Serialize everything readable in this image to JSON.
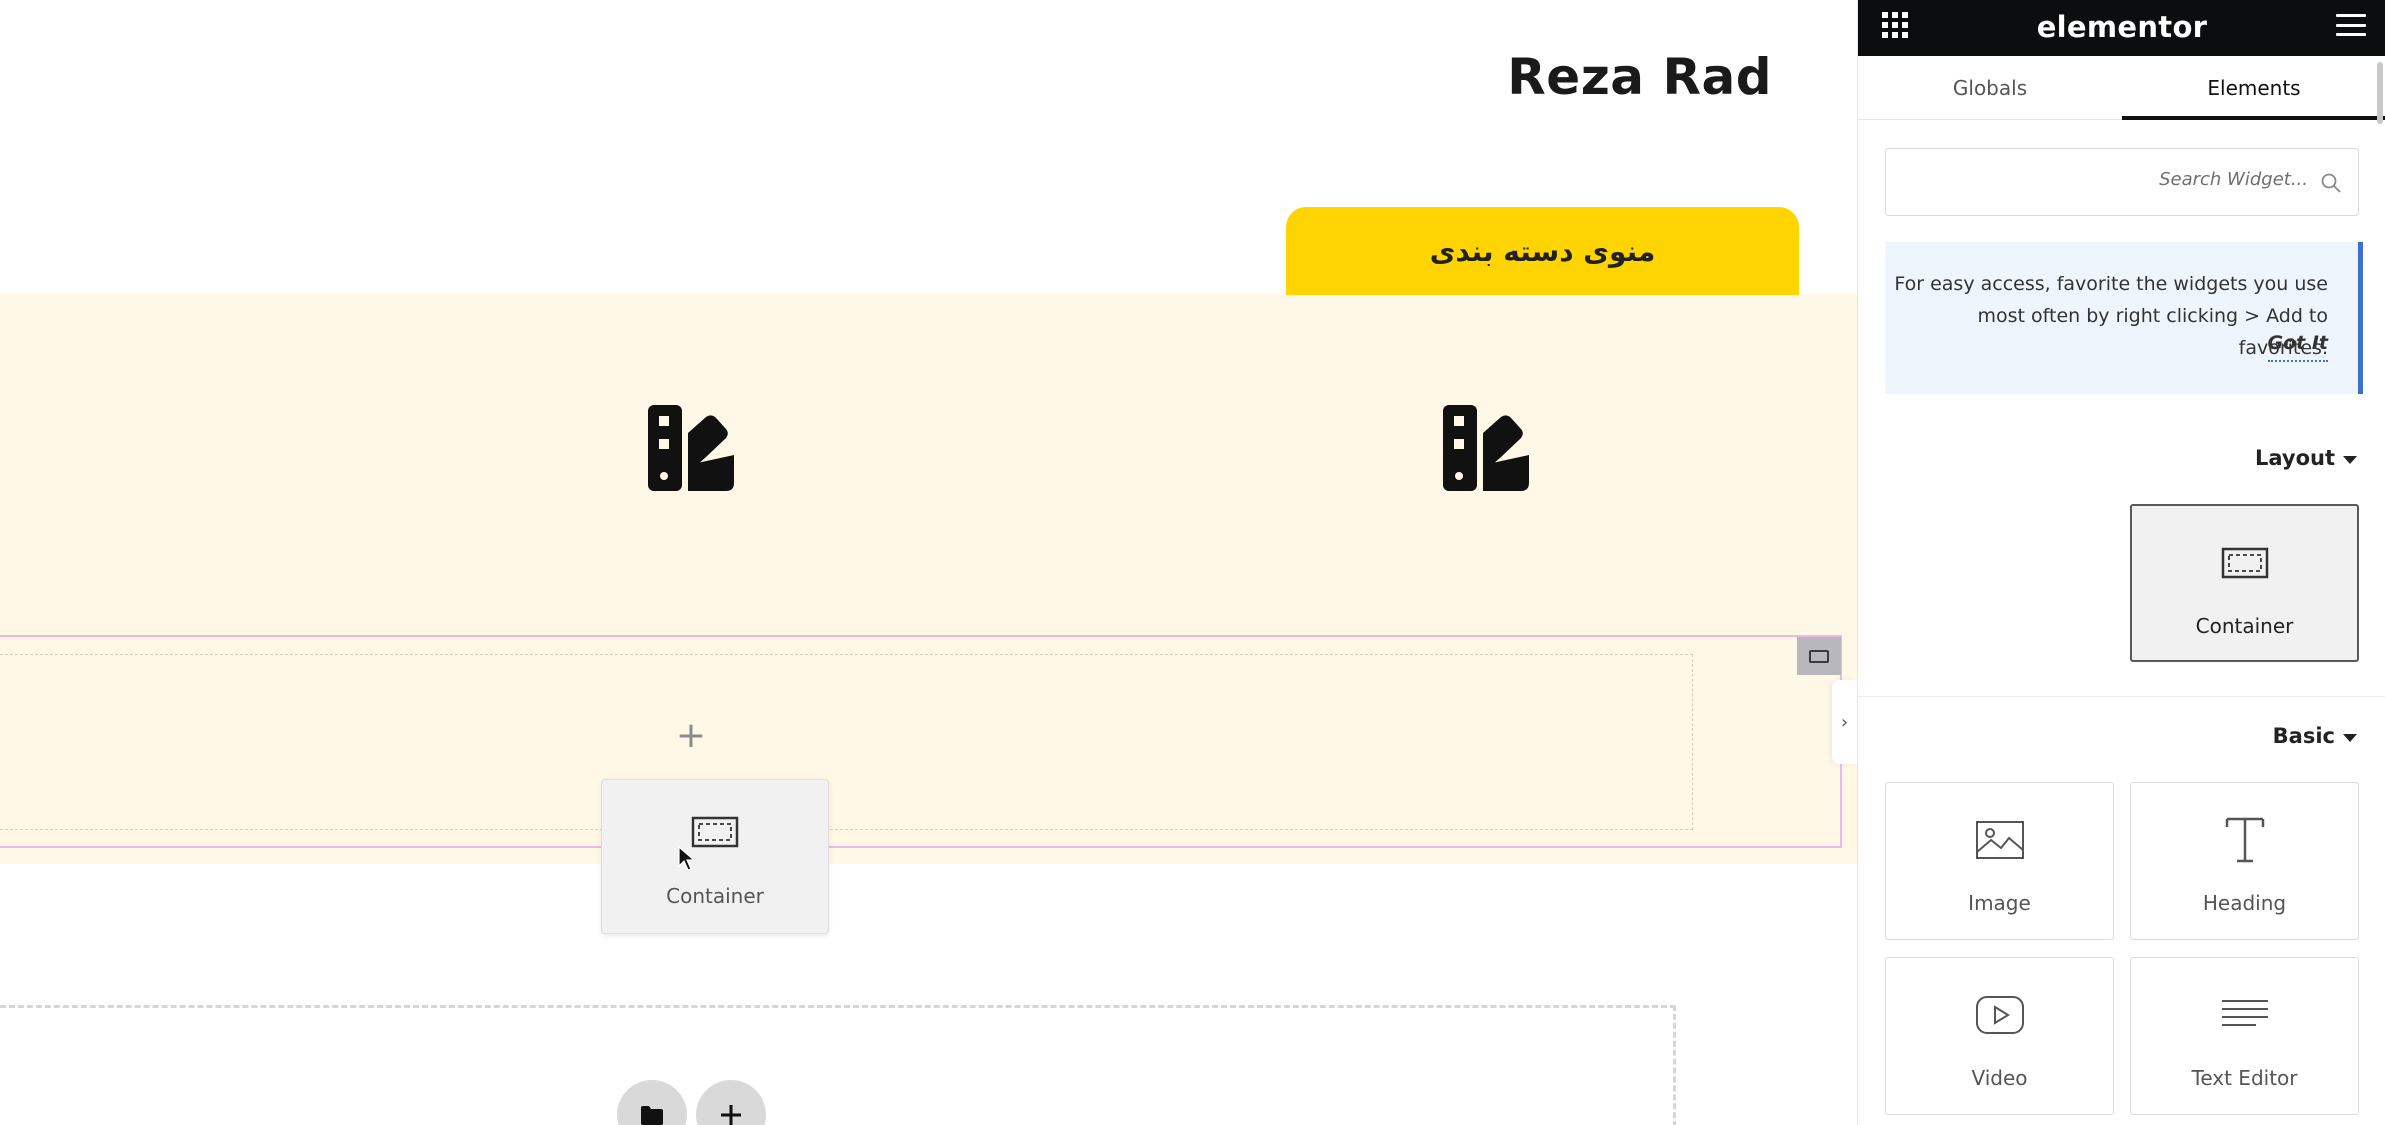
{
  "canvas": {
    "site_title": "Reza Rad",
    "category_tab": "منوی دسته بندی",
    "drop_placeholder_plus": "+",
    "dragged_widget": {
      "label": "Container",
      "icon": "container-icon"
    },
    "empty_section_buttons": [
      {
        "name": "folder-button",
        "icon": "folder-icon"
      },
      {
        "name": "add-section-button",
        "icon": "plus-icon"
      }
    ]
  },
  "panel": {
    "brand": "elementor",
    "tabs": [
      {
        "label": "Globals",
        "active": false
      },
      {
        "label": "Elements",
        "active": true
      }
    ],
    "search": {
      "placeholder": "Search Widget..."
    },
    "notice": {
      "text": "For easy access, favorite the widgets you use most often by right clicking > Add to favorites.",
      "action": "Got It"
    },
    "layout": {
      "title": "Layout",
      "widgets": [
        {
          "label": "Container",
          "icon": "container-icon"
        }
      ]
    },
    "basic": {
      "title": "Basic",
      "widgets": [
        {
          "label": "Image",
          "icon": "image-icon"
        },
        {
          "label": "Heading",
          "icon": "heading-icon"
        },
        {
          "label": "Video",
          "icon": "video-icon"
        },
        {
          "label": "Text Editor",
          "icon": "text-editor-icon"
        }
      ]
    }
  },
  "colors": {
    "accent_yellow": "#ffd400",
    "section_bg": "#fff8e6",
    "drop_outline": "#f0b6ea",
    "panel_header": "#0c0d0e",
    "notice_bg": "#eef5fc",
    "notice_border": "#3c6fd4"
  }
}
